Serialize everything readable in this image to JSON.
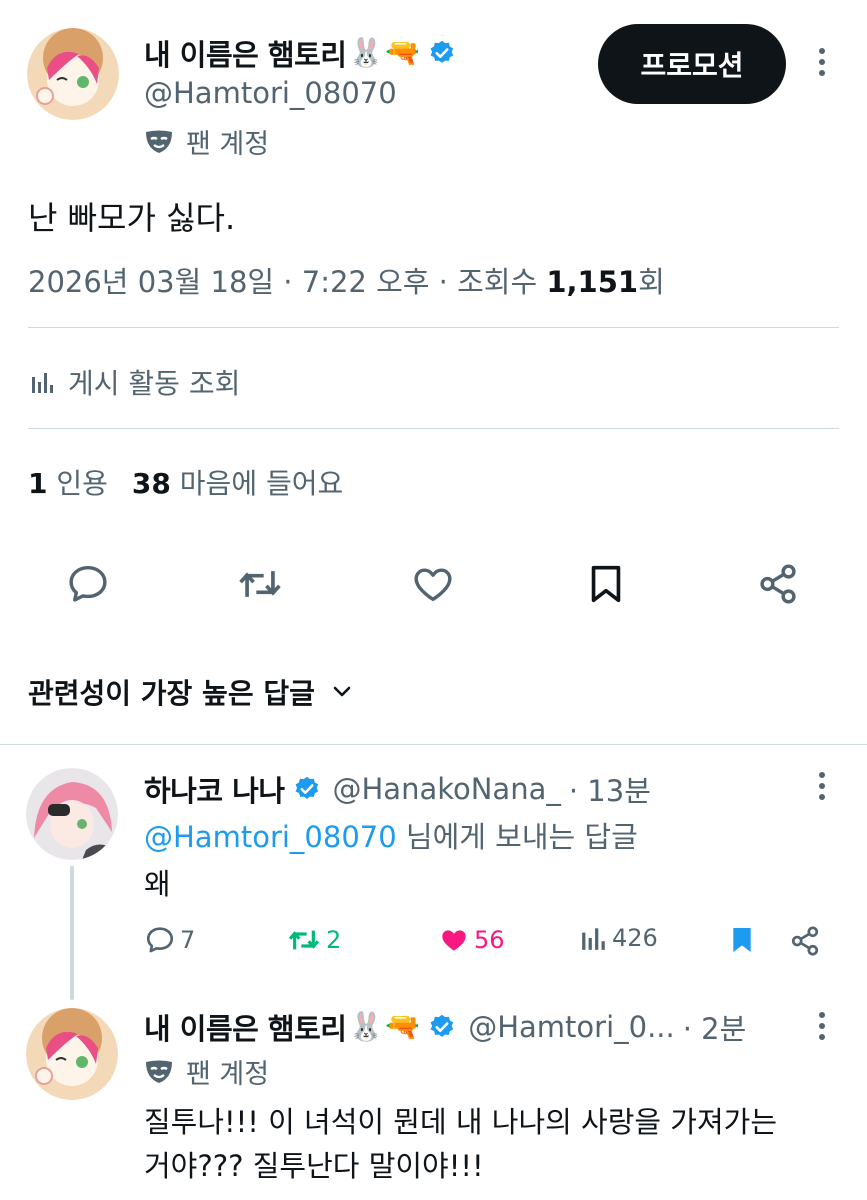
{
  "tweet": {
    "author": {
      "display_name": "내 이름은 햄토리",
      "name_emoji_1": "🐰",
      "name_emoji_2": "🔫",
      "handle": "@Hamtori_08070",
      "fan_label": "팬 계정"
    },
    "promo_label": "프로모션",
    "text": "난 빠모가 싫다.",
    "meta_prefix": "2026년 03월 18일 · 7:22 오후 · 조회수 ",
    "views": "1,151",
    "views_suffix": "회",
    "activity_label": "게시 활동 조회",
    "quotes_count": "1",
    "quotes_label": "인용",
    "likes_count": "38",
    "likes_label": "마음에 들어요"
  },
  "sort_label": "관련성이 가장 높은 답글",
  "replies": [
    {
      "display_name": "하나코 나나",
      "handle": "@HanakoNana_",
      "time": "· 13분",
      "reply_to_mention": "@Hamtori_08070",
      "reply_to_suffix": " 님에게 보내는 답글",
      "text": "왜",
      "comments": "7",
      "retweets": "2",
      "likes": "56",
      "views": "426"
    },
    {
      "display_name": "내 이름은 햄토리",
      "name_emoji_1": "🐰",
      "name_emoji_2": "🔫",
      "handle": "@Hamtori_0...",
      "time": "· 2분",
      "fan_label": "팬 계정",
      "text_line1": "질투나!!! 이 녀석이 뭔데 내 나나의 사랑을 가져가는",
      "text_line2": "거야??? 질투난다 말이야!!!"
    }
  ],
  "colors": {
    "text": "#0f1419",
    "secondary": "#536471",
    "accent": "#1d9bf0",
    "retweet": "#00ba7c",
    "like": "#f91880"
  }
}
